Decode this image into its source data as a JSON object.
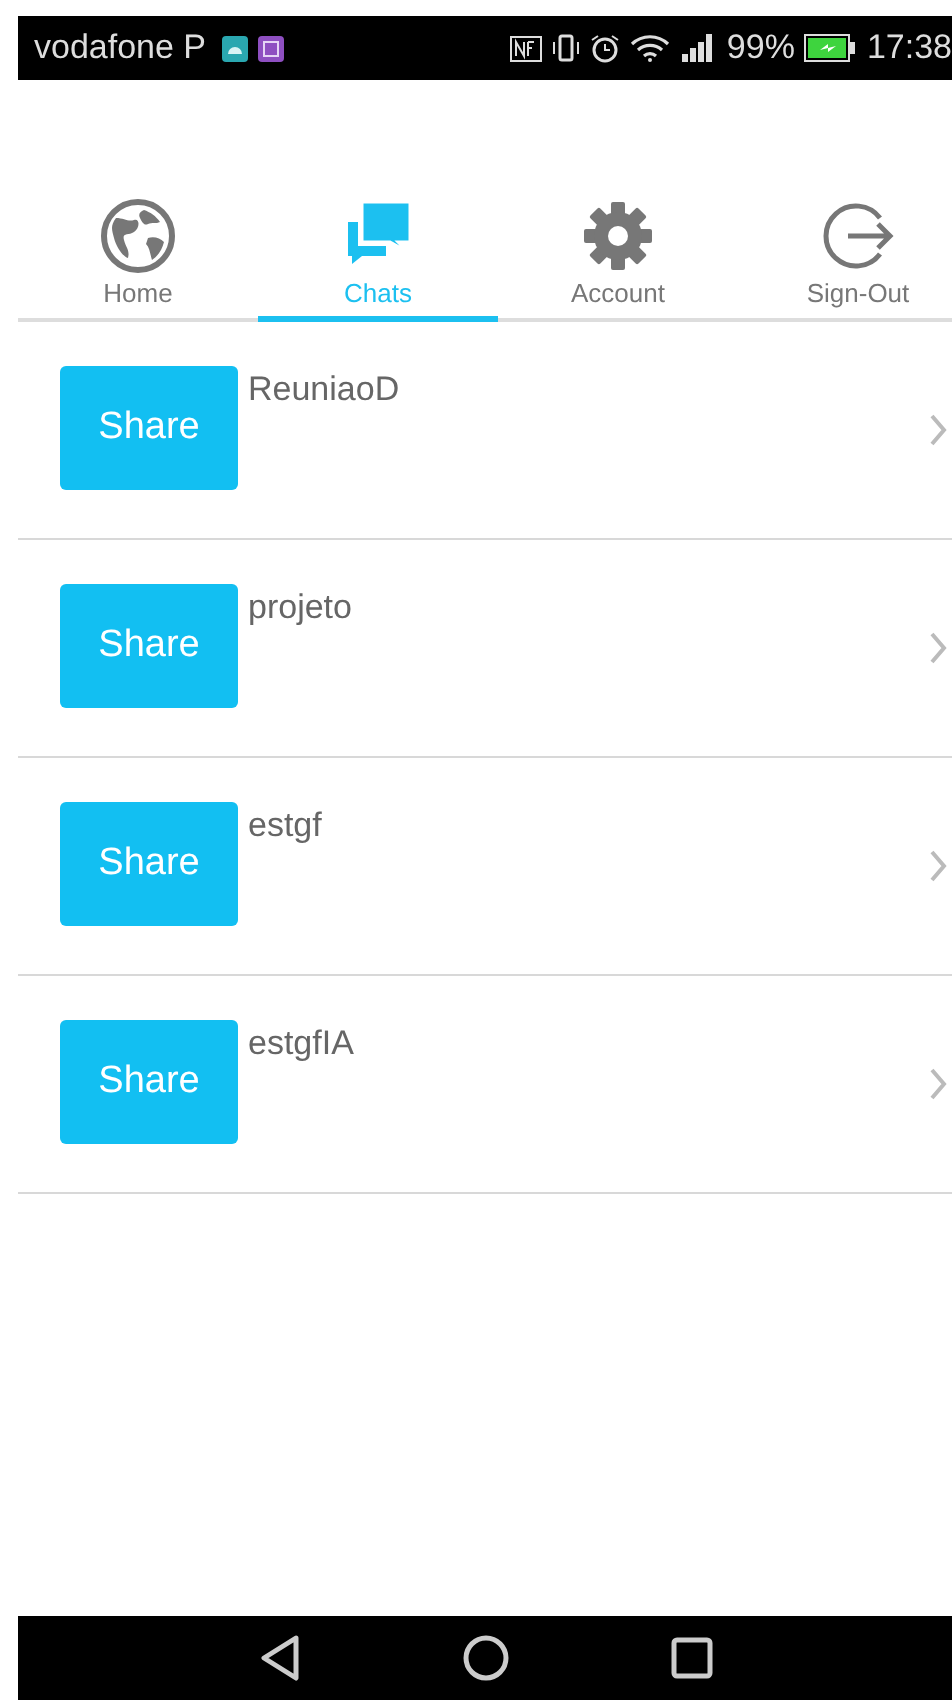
{
  "status_bar": {
    "carrier": "vodafone P",
    "battery": "99%",
    "time": "17:38"
  },
  "tabs": [
    {
      "label": "Home",
      "kind": "globe",
      "selected": false
    },
    {
      "label": "Chats",
      "kind": "chat",
      "selected": true
    },
    {
      "label": "Account",
      "kind": "gear",
      "selected": false
    },
    {
      "label": "Sign-Out",
      "kind": "exit",
      "selected": false
    }
  ],
  "chats": [
    {
      "name": "ReuniaoD",
      "button": "Share"
    },
    {
      "name": "projeto",
      "button": "Share"
    },
    {
      "name": "estgf",
      "button": "Share"
    },
    {
      "name": "estgfIA",
      "button": "Share"
    }
  ]
}
